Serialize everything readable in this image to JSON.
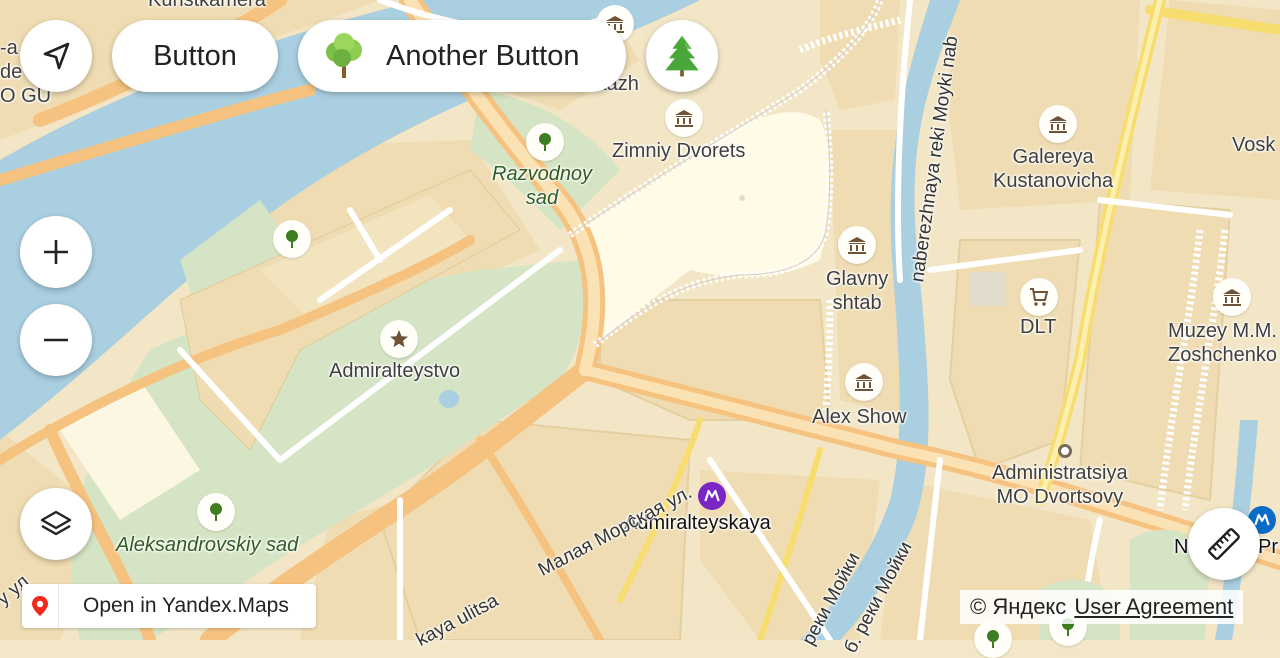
{
  "controls": {
    "button_label": "Button",
    "another_button_label": "Another Button"
  },
  "map": {
    "labels": {
      "kunstkamera": "Kunstkamera",
      "left_top_1": "-a",
      "left_top_2": "de",
      "left_top_3": "O GU",
      "hitazh": "Ermitazh",
      "zimniy": "Zimniy Dvorets",
      "razvodnoy": "Razvodnoy\nsad",
      "admiralteystvo": "Admiralteystvo",
      "aleksandrovskiy": "Aleksandrovskiy sad",
      "admiralteyskaya": "Admiralteyskaya",
      "glavny": "Glavny\nshtab",
      "alex_show": "Alex Show",
      "galereya": "Galereya\nKustanovicha",
      "dlt": "DLT",
      "muzey": "Muzey M.M.\nZoshchenko",
      "vosk": "Vosk",
      "administratsiya": "Administratsiya\nMO Dvortsovy",
      "naberezhnaya": "naberezhnaya reki Moyki nab",
      "malaya_morskaya": "Малая Морская ул.",
      "kaya_ulitsa": "kaya ulitsa",
      "reki_moyki_1": "реки Мойки",
      "reki_moyki_2": "б. реки Мойки",
      "nevsky": "N",
      "nevsky_pr": "Pr",
      "left_bottom": "у ул"
    }
  },
  "footer": {
    "open_in_label": "Open in Yandex.Maps",
    "copyright": "© Яндекс",
    "user_agreement": "User Agreement"
  },
  "colors": {
    "water": "#a9cfe0",
    "park": "#d4e4c5",
    "block": "#f1ddb3",
    "road_major": "#f6c27f",
    "road_yellow": "#f7e27a",
    "square": "#fffbe8"
  }
}
